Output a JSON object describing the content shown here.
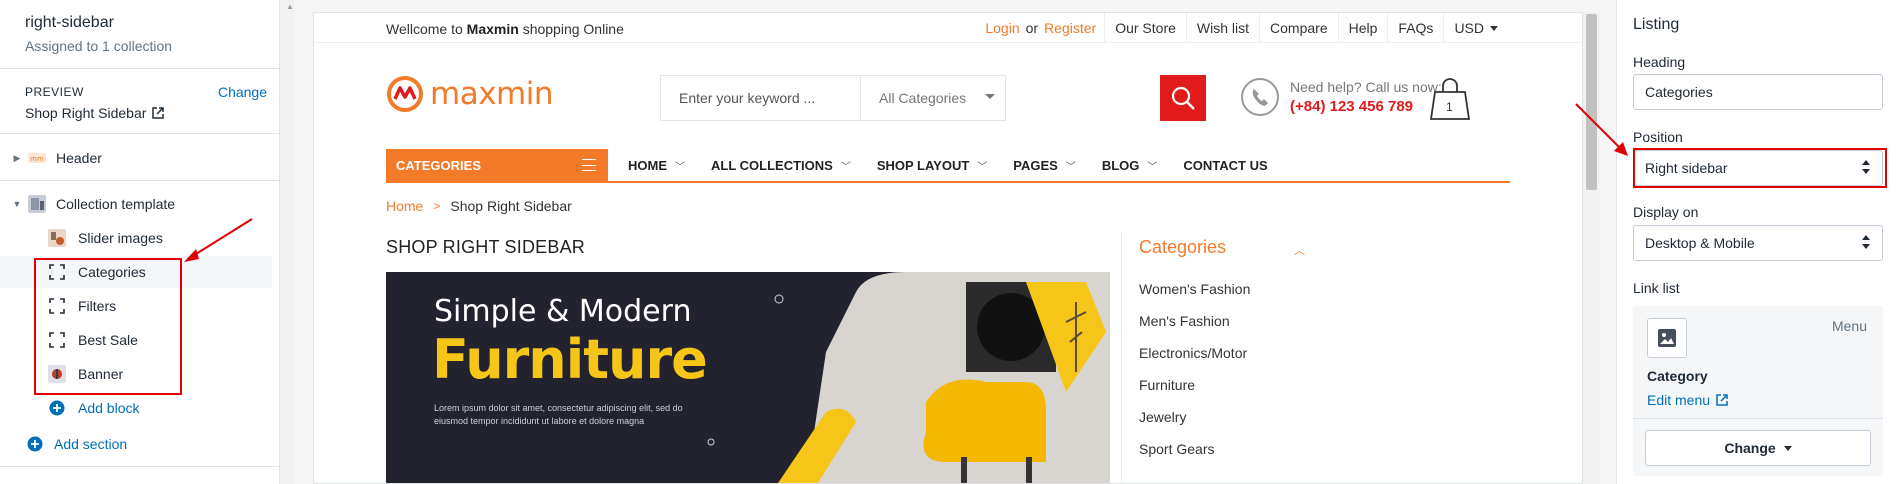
{
  "left_panel": {
    "title": "right-sidebar",
    "subtitle": "Assigned to 1 collection",
    "preview_label": "PREVIEW",
    "change_label": "Change",
    "preview_value": "Shop Right Sidebar",
    "header_label": "Header",
    "collection_label": "Collection template",
    "blocks": [
      {
        "label": "Slider images"
      },
      {
        "label": "Categories"
      },
      {
        "label": "Filters"
      },
      {
        "label": "Best Sale"
      },
      {
        "label": "Banner"
      }
    ],
    "add_block": "Add block",
    "add_section": "Add section"
  },
  "store": {
    "welcome_prefix": "Wellcome to",
    "welcome_brand": "Maxmin",
    "welcome_suffix": "shopping Online",
    "login": "Login",
    "or": "or",
    "register": "Register",
    "top_links": [
      "Our Store",
      "Wish list",
      "Compare",
      "Help",
      "FAQs"
    ],
    "currency": "USD",
    "logo_text": "maxmin",
    "search_placeholder": "Enter your keyword ...",
    "search_category": "All Categories",
    "help_line1": "Need help? Call us now:",
    "help_phone": "(+84) 123 456 789",
    "cart_count": "1",
    "categories_btn": "CATEGORIES",
    "nav": [
      {
        "label": "HOME",
        "has_dropdown": true
      },
      {
        "label": "ALL COLLECTIONS",
        "has_dropdown": true
      },
      {
        "label": "SHOP LAYOUT",
        "has_dropdown": true
      },
      {
        "label": "PAGES",
        "has_dropdown": true
      },
      {
        "label": "BLOG",
        "has_dropdown": true
      },
      {
        "label": "CONTACT US",
        "has_dropdown": false
      }
    ],
    "breadcrumb_home": "Home",
    "breadcrumb_current": "Shop Right Sidebar",
    "page_heading": "SHOP RIGHT SIDEBAR",
    "banner": {
      "subtitle": "Simple & Modern",
      "title": "Furniture",
      "body": "Lorem ipsum dolor sit amet, consectetur adipiscing elit, sed do eiusmod tempor incididunt ut labore et dolore magna"
    },
    "sidebar_title": "Categories",
    "sidebar_items": [
      "Women's Fashion",
      "Men's Fashion",
      "Electronics/Motor",
      "Furniture",
      "Jewelry",
      "Sport Gears"
    ]
  },
  "right_panel": {
    "title": "Listing",
    "heading_label": "Heading",
    "heading_value": "Categories",
    "position_label": "Position",
    "position_value": "Right sidebar",
    "display_label": "Display on",
    "display_value": "Desktop & Mobile",
    "link_list_label": "Link list",
    "menu_tag": "Menu",
    "menu_name": "Category",
    "edit_menu": "Edit menu",
    "change_btn": "Change"
  },
  "colors": {
    "accent_orange": "#f27a29",
    "accent_red": "#e11b1b",
    "annotation_red": "#e00000",
    "shopify_link": "#006fbb"
  }
}
